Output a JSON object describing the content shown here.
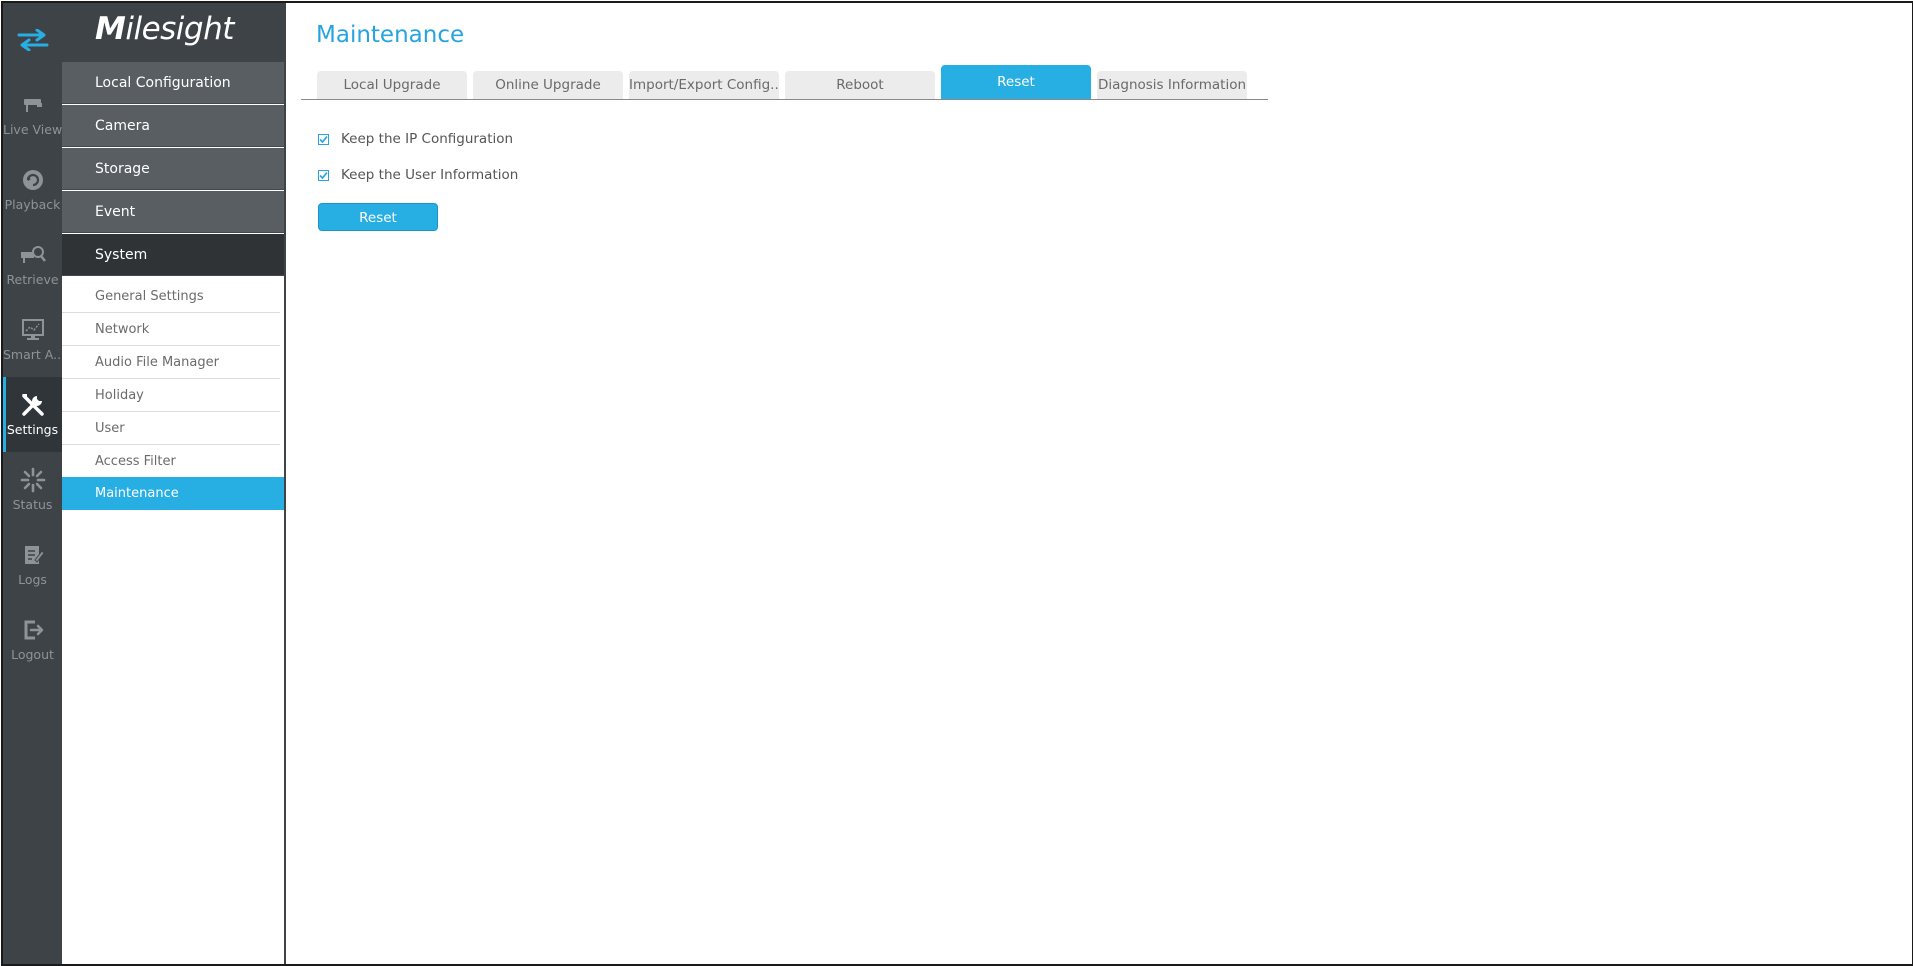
{
  "brand": {
    "logo_text": "ilesight",
    "logo_initial": "M"
  },
  "rail": {
    "items": [
      {
        "label": "Live View",
        "icon": "live-view-icon"
      },
      {
        "label": "Playback",
        "icon": "playback-icon"
      },
      {
        "label": "Retrieve",
        "icon": "retrieve-icon"
      },
      {
        "label": "Smart A...",
        "icon": "smart-analysis-icon"
      },
      {
        "label": "Settings",
        "icon": "settings-icon"
      },
      {
        "label": "Status",
        "icon": "status-icon"
      },
      {
        "label": "Logs",
        "icon": "logs-icon"
      },
      {
        "label": "Logout",
        "icon": "logout-icon"
      }
    ],
    "active": "Settings"
  },
  "menu": {
    "main_items": [
      {
        "label": "Local Configuration"
      },
      {
        "label": "Camera"
      },
      {
        "label": "Storage"
      },
      {
        "label": "Event"
      },
      {
        "label": "System"
      }
    ],
    "active_main": "System",
    "sub_items": [
      {
        "label": "General Settings"
      },
      {
        "label": "Network"
      },
      {
        "label": "Audio File Manager"
      },
      {
        "label": "Holiday"
      },
      {
        "label": "User"
      },
      {
        "label": "Access Filter"
      },
      {
        "label": "Maintenance"
      }
    ],
    "active_sub": "Maintenance"
  },
  "page": {
    "title": "Maintenance",
    "tabs": [
      {
        "label": "Local Upgrade"
      },
      {
        "label": "Online Upgrade"
      },
      {
        "label": "Import/Export Config..."
      },
      {
        "label": "Reboot"
      },
      {
        "label": "Reset"
      },
      {
        "label": "Diagnosis Information"
      }
    ],
    "active_tab": "Reset",
    "options": [
      {
        "label": "Keep the IP Configuration",
        "checked": true
      },
      {
        "label": "Keep the User Information",
        "checked": true
      }
    ],
    "reset_button": "Reset"
  },
  "colors": {
    "accent": "#27aee3",
    "title": "#27a4dd",
    "rail_bg": "#3e4347",
    "menu_item_bg": "#585e62",
    "menu_item_active_bg": "#2f3336"
  }
}
